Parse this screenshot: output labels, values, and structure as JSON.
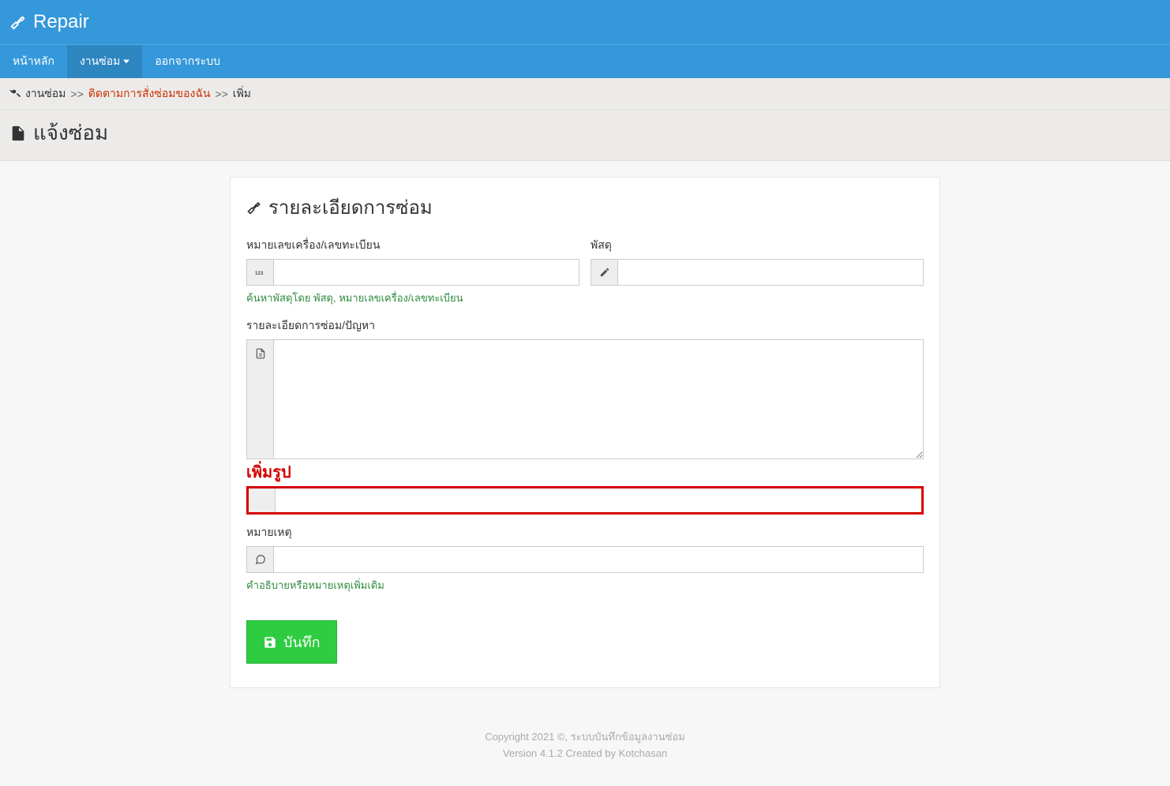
{
  "header": {
    "title": "Repair"
  },
  "nav": {
    "home": "หน้าหลัก",
    "repair": "งานซ่อม",
    "logout": "ออกจากระบบ"
  },
  "breadcrumb": {
    "item1": "งานซ่อม",
    "item2": "ติดตามการสั่งซ่อมของฉัน",
    "item3": "เพิ่ม",
    "sep": ">>"
  },
  "page_title": "แจ้งซ่อม",
  "form": {
    "card_title": "รายละเอียดการซ่อม",
    "serial_label": "หมายเลขเครื่อง/เลขทะเบียน",
    "serial_hint": "ค้นหาพัสดุโดย พัสดุ, หมายเลขเครื่อง/เลขทะเบียน",
    "product_label": "พัสดุ",
    "desc_label": "รายละเอียดการซ่อม/ปัญหา",
    "add_image": "เพิ่มรูป",
    "note_label": "หมายเหตุ",
    "note_hint": "คำอธิบายหรือหมายเหตุเพิ่มเติม",
    "save": "บันทึก"
  },
  "footer": {
    "line1": "Copyright 2021 ©, ระบบบันทึกข้อมูลงานซ่อม",
    "line2": "Version 4.1.2 Created by Kotchasan"
  }
}
